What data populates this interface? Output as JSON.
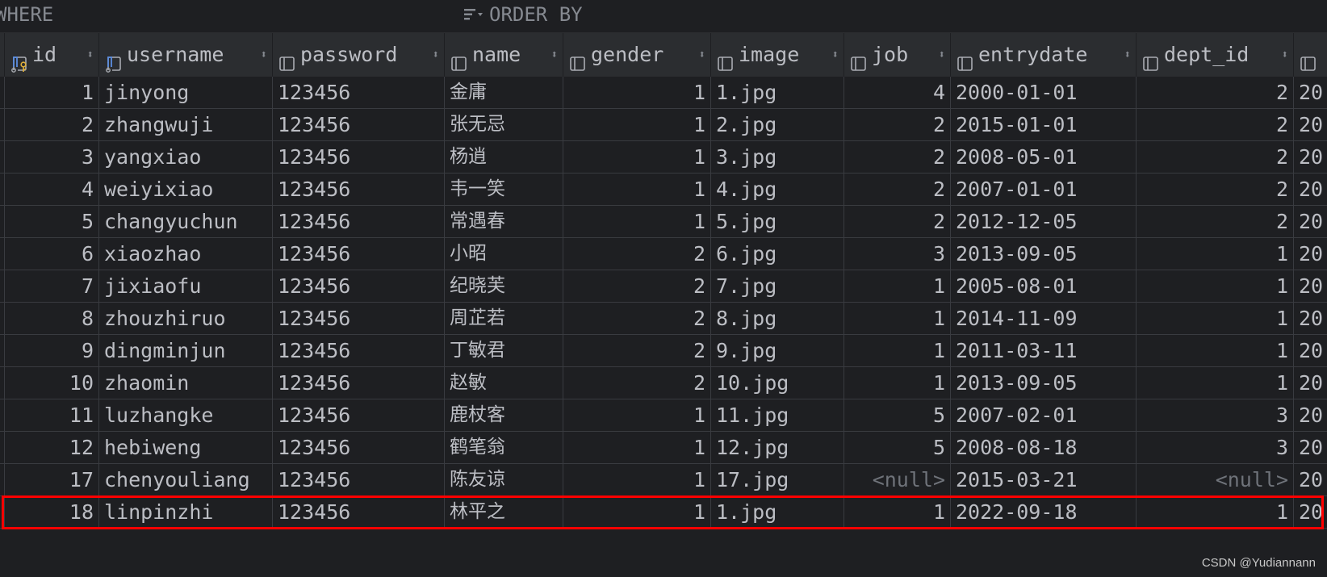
{
  "filter": {
    "where_label": "WHERE",
    "order_by_label": "ORDER BY"
  },
  "columns": [
    {
      "label": "id",
      "icon": "primary-key-column-icon"
    },
    {
      "label": "username",
      "icon": "indexed-column-icon"
    },
    {
      "label": "password",
      "icon": "column-icon"
    },
    {
      "label": "name",
      "icon": "column-icon"
    },
    {
      "label": "gender",
      "icon": "column-icon"
    },
    {
      "label": "image",
      "icon": "column-icon"
    },
    {
      "label": "job",
      "icon": "column-icon"
    },
    {
      "label": "entrydate",
      "icon": "column-icon"
    },
    {
      "label": "dept_id",
      "icon": "column-icon"
    },
    {
      "label": "",
      "icon": "column-icon"
    }
  ],
  "rows": [
    {
      "id": "1",
      "username": "jinyong",
      "password": "123456",
      "name": "金庸",
      "gender": "1",
      "image": "1.jpg",
      "job": "4",
      "entrydate": "2000-01-01",
      "dept_id": "2",
      "extra": "20"
    },
    {
      "id": "2",
      "username": "zhangwuji",
      "password": "123456",
      "name": "张无忌",
      "gender": "1",
      "image": "2.jpg",
      "job": "2",
      "entrydate": "2015-01-01",
      "dept_id": "2",
      "extra": "20"
    },
    {
      "id": "3",
      "username": "yangxiao",
      "password": "123456",
      "name": "杨逍",
      "gender": "1",
      "image": "3.jpg",
      "job": "2",
      "entrydate": "2008-05-01",
      "dept_id": "2",
      "extra": "20"
    },
    {
      "id": "4",
      "username": "weiyixiao",
      "password": "123456",
      "name": "韦一笑",
      "gender": "1",
      "image": "4.jpg",
      "job": "2",
      "entrydate": "2007-01-01",
      "dept_id": "2",
      "extra": "20"
    },
    {
      "id": "5",
      "username": "changyuchun",
      "password": "123456",
      "name": "常遇春",
      "gender": "1",
      "image": "5.jpg",
      "job": "2",
      "entrydate": "2012-12-05",
      "dept_id": "2",
      "extra": "20"
    },
    {
      "id": "6",
      "username": "xiaozhao",
      "password": "123456",
      "name": "小昭",
      "gender": "2",
      "image": "6.jpg",
      "job": "3",
      "entrydate": "2013-09-05",
      "dept_id": "1",
      "extra": "20"
    },
    {
      "id": "7",
      "username": "jixiaofu",
      "password": "123456",
      "name": "纪晓芙",
      "gender": "2",
      "image": "7.jpg",
      "job": "1",
      "entrydate": "2005-08-01",
      "dept_id": "1",
      "extra": "20"
    },
    {
      "id": "8",
      "username": "zhouzhiruo",
      "password": "123456",
      "name": "周芷若",
      "gender": "2",
      "image": "8.jpg",
      "job": "1",
      "entrydate": "2014-11-09",
      "dept_id": "1",
      "extra": "20"
    },
    {
      "id": "9",
      "username": "dingminjun",
      "password": "123456",
      "name": "丁敏君",
      "gender": "2",
      "image": "9.jpg",
      "job": "1",
      "entrydate": "2011-03-11",
      "dept_id": "1",
      "extra": "20"
    },
    {
      "id": "10",
      "username": "zhaomin",
      "password": "123456",
      "name": "赵敏",
      "gender": "2",
      "image": "10.jpg",
      "job": "1",
      "entrydate": "2013-09-05",
      "dept_id": "1",
      "extra": "20"
    },
    {
      "id": "11",
      "username": "luzhangke",
      "password": "123456",
      "name": "鹿杖客",
      "gender": "1",
      "image": "11.jpg",
      "job": "5",
      "entrydate": "2007-02-01",
      "dept_id": "3",
      "extra": "20"
    },
    {
      "id": "12",
      "username": "hebiweng",
      "password": "123456",
      "name": "鹤笔翁",
      "gender": "1",
      "image": "12.jpg",
      "job": "5",
      "entrydate": "2008-08-18",
      "dept_id": "3",
      "extra": "20"
    },
    {
      "id": "17",
      "username": "chenyouliang",
      "password": "123456",
      "name": "陈友谅",
      "gender": "1",
      "image": "17.jpg",
      "job": "<null>",
      "entrydate": "2015-03-21",
      "dept_id": "<null>",
      "extra": "20"
    },
    {
      "id": "18",
      "username": "linpinzhi",
      "password": "123456",
      "name": "林平之",
      "gender": "1",
      "image": "1.jpg",
      "job": "1",
      "entrydate": "2022-09-18",
      "dept_id": "1",
      "extra": "20"
    }
  ],
  "highlighted_row_id": "18",
  "watermark": "CSDN @Yudiannann",
  "colors": {
    "highlight": "#ff0000",
    "background": "#1e1f22",
    "header": "#2b2d30",
    "key": "#e0b03a",
    "index": "#5b8de0"
  }
}
